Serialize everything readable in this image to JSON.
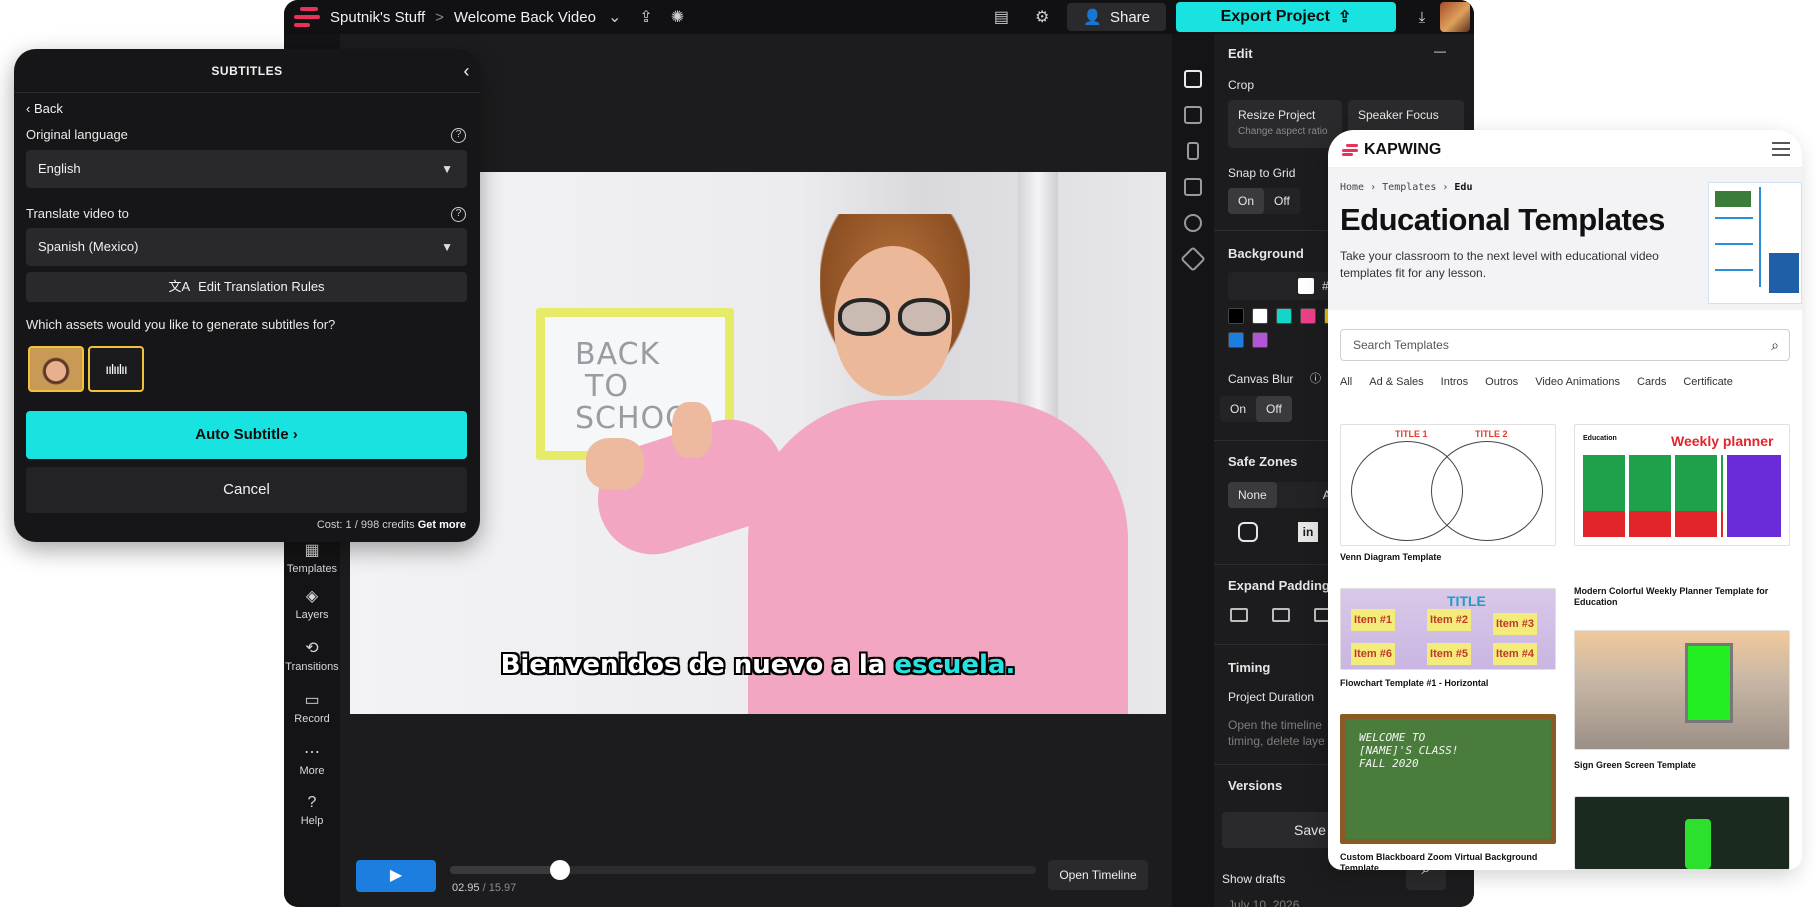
{
  "editor": {
    "breadcrumb": {
      "workspace": "Sputnik's Stuff",
      "separator": ">",
      "project": "Welcome Back Video"
    },
    "share_label": "Share",
    "export_label": "Export Project",
    "left_rail": [
      "Templates",
      "Layers",
      "Transitions",
      "Record",
      "More",
      "Help"
    ],
    "subtitle_caption": {
      "before": "Bienvenidos de nuevo a la ",
      "highlight": "escuela."
    },
    "board_text": [
      "BACK",
      "TO",
      "SCHOO"
    ],
    "playback": {
      "current": "02.95",
      "separator": " / ",
      "total": "15.97",
      "open_timeline": "Open Timeline",
      "progress": 0.187
    },
    "properties": {
      "edit_title": "Edit",
      "crop_label": "Crop",
      "resize_project": "Resize Project",
      "resize_sub": "Change aspect ratio",
      "speaker_focus": "Speaker Focus",
      "snap_to_grid": "Snap to Grid",
      "on": "On",
      "off": "Off",
      "background": "Background",
      "bg_hex": "#FF",
      "swatches": [
        "#000000",
        "#ffffff",
        "#14d6c8",
        "#ef3f8a",
        "#f2c200",
        "#1c7fe0",
        "#b455d6"
      ],
      "canvas_blur": "Canvas Blur",
      "safe_zones": "Safe Zones",
      "none": "None",
      "all": "All",
      "expand_padding": "Expand Padding",
      "timing": "Timing",
      "project_duration": "Project Duration",
      "duration_hint_1": "Open the timeline",
      "duration_hint_2": "timing, delete laye",
      "versions": "Versions",
      "save_label": "Save cur",
      "show_drafts": "Show drafts",
      "draft_date": "July 10, 2026"
    }
  },
  "subtitles": {
    "title": "SUBTITLES",
    "back": "Back",
    "original_language_label": "Original language",
    "original_language": "English",
    "translate_label": "Translate video to",
    "translate_value": "Spanish (Mexico)",
    "edit_rules": "Edit Translation Rules",
    "assets_question": "Which assets would you like to generate subtitles for?",
    "auto_subtitle": "Auto Subtitle",
    "cancel": "Cancel",
    "cost_text": "Cost: 1 / 998 credits",
    "get_more": "Get more"
  },
  "kapwing": {
    "brand": "KAPWING",
    "breadcrumb": {
      "home": "Home",
      "templates": "Templates",
      "current": "Edu"
    },
    "title": "Educational Templates",
    "lede": "Take your classroom to the next level with educational video templates fit for any lesson.",
    "search_placeholder": "Search Templates",
    "chips": [
      "All",
      "Ad & Sales",
      "Intros",
      "Outros",
      "Video Animations",
      "Cards",
      "Certificate"
    ],
    "venn": {
      "t1": "TITLE 1",
      "t2": "TITLE 2"
    },
    "planner": {
      "brand": "Education",
      "title": "Weekly planner"
    },
    "flow": {
      "title": "TITLE",
      "items": [
        "Item #1",
        "Item #2",
        "Item #3",
        "Item #6",
        "Item #5",
        "Item #4"
      ]
    },
    "board_text": "WELCOME TO\n[NAME]'S CLASS!\nFALL 2020",
    "templates": [
      "Venn Diagram Template",
      "Modern Colorful Weekly Planner Template for Education",
      "Flowchart Template #1 - Horizontal",
      "Sign Green Screen Template",
      "Custom Blackboard Zoom Virtual Background Template"
    ]
  }
}
